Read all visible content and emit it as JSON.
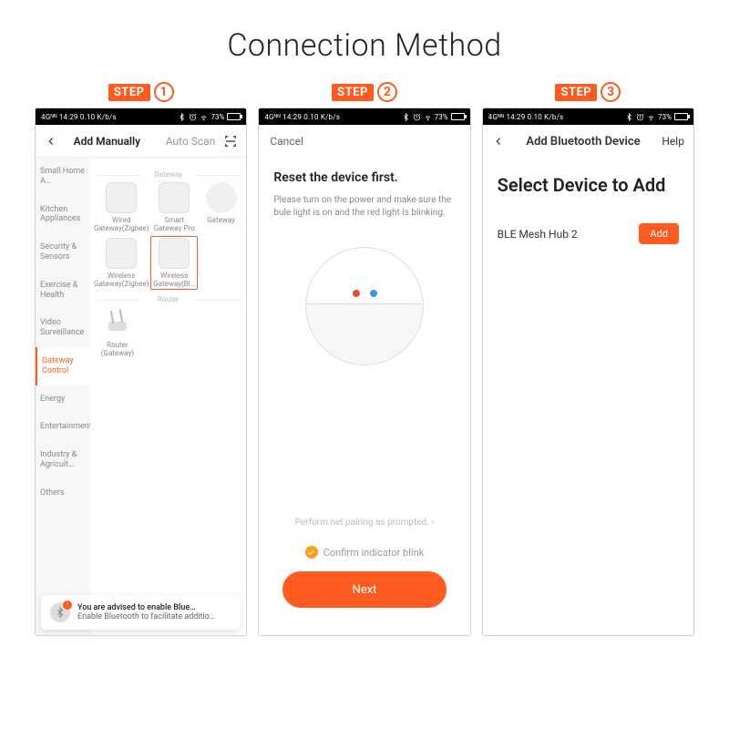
{
  "page_title": "Connection Method",
  "steps": {
    "label": "STEP",
    "nums": [
      "1",
      "2",
      "3"
    ]
  },
  "statusbar": {
    "left": "4Gᴺᴺ 14:29 0.10 K/b/s",
    "battery_pct": "73%"
  },
  "screen1": {
    "header": {
      "tab_active": "Add Manually",
      "tab_other": "Auto Scan"
    },
    "sidebar": [
      "Small Home A…",
      "Kitchen Appliances",
      "Security & Sensors",
      "Exercise & Health",
      "Video Surveillance",
      "Gateway Control",
      "Energy",
      "Entertainment",
      "Industry & Agricult…",
      "Others"
    ],
    "sidebar_active_index": 5,
    "section_gateway": "Gateway",
    "section_router": "Router",
    "devices_row1": [
      "Wired Gateway(Zigbee)",
      "Smart Gateway Pro",
      "Gateway"
    ],
    "devices_row2": [
      "Wireless Gateway(Zigbee)",
      "Wireless Gateway(Bl…"
    ],
    "devices_row3": [
      "Router (Gateway)"
    ],
    "toast": {
      "title": "You are advised to enable Blue…",
      "sub": "Enable Bluetooth to facilitate additio…",
      "badge": "!"
    }
  },
  "screen2": {
    "cancel": "Cancel",
    "heading": "Reset the device first.",
    "body": "Please turn on the power and make sure the bule light is on and the red light is blinking.",
    "prompt": "Perform net pairing as prompted.  ›",
    "confirm": "Confirm indicator blink",
    "next": "Next"
  },
  "screen3": {
    "title": "Add Bluetooth Device",
    "help": "Help",
    "heading": "Select Device to Add",
    "device": "BLE Mesh Hub 2",
    "add": "Add"
  }
}
